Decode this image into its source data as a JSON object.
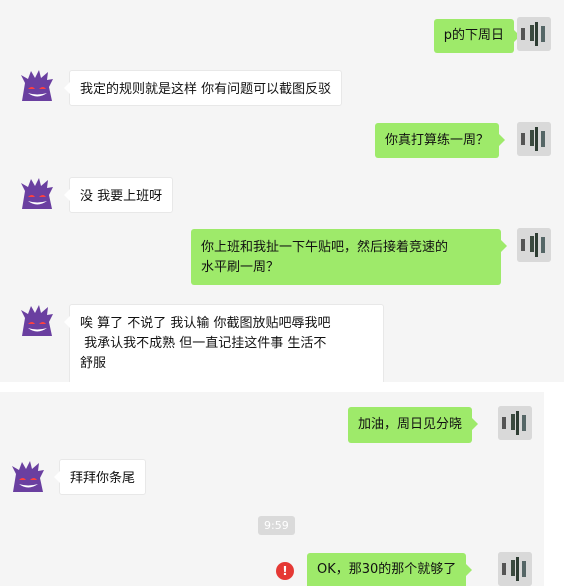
{
  "chat": {
    "messages": [
      {
        "side": "right",
        "text": "p的下周日"
      },
      {
        "side": "left",
        "text": "我定的规则就是这样 你有问题可以截图反驳"
      },
      {
        "side": "right",
        "text": "你真打算练一周？"
      },
      {
        "side": "left",
        "text": "没 我要上班呀"
      },
      {
        "side": "right",
        "lines": [
          "你上班和我扯一下午贴吧，然后接着竞速的",
          "水平刷一周？"
        ]
      },
      {
        "side": "left",
        "lines": [
          "唉 算了 不说了 我认输 你截图放贴吧辱我吧",
          " 我承认我不成熟 但一直记挂这件事 生活不",
          "舒服"
        ]
      },
      {
        "side": "right",
        "text": "加油，周日见分晓"
      },
      {
        "side": "left",
        "text": "拜拜你条尾"
      },
      {
        "side": "right",
        "text": "OK，那30的那个就够了",
        "status": "failed"
      }
    ],
    "timestamp": "9:59"
  },
  "colors": {
    "incoming_bubble": "#ffffff",
    "outgoing_bubble": "#9eea6a",
    "background": "#f5f5f5",
    "error": "#e53935"
  },
  "icons": {
    "contact_avatar": "gengar-avatar",
    "self_avatar": "user-avatar",
    "send_failed": "error-icon"
  }
}
